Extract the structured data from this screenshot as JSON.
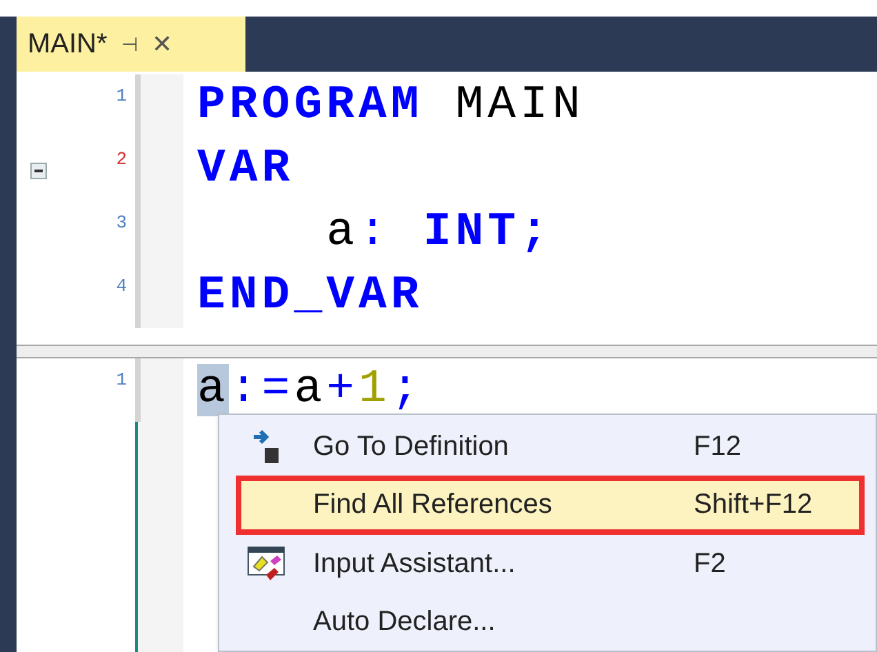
{
  "tab": {
    "title": "MAIN*",
    "pin": "⊣",
    "close": "✕",
    "selected": true
  },
  "top_pane": {
    "lines": [
      {
        "number": "1",
        "changed": false,
        "foldable": false,
        "tokens": [
          {
            "text": "PROGRAM",
            "kind": "keyword"
          },
          {
            "text": " MAIN",
            "kind": "ident"
          }
        ]
      },
      {
        "number": "2",
        "changed": true,
        "foldable": true,
        "tokens": [
          {
            "text": "VAR",
            "kind": "keyword"
          }
        ]
      },
      {
        "number": "3",
        "changed": false,
        "foldable": false,
        "tokens": [
          {
            "text": "    a",
            "kind": "ident"
          },
          {
            "text": ":",
            "kind": "punct"
          },
          {
            "text": " INT;",
            "kind": "keyword"
          }
        ]
      },
      {
        "number": "4",
        "changed": false,
        "foldable": false,
        "tokens": [
          {
            "text": "END_VAR",
            "kind": "keyword"
          }
        ]
      }
    ]
  },
  "bottom_pane": {
    "lines": [
      {
        "number": "1",
        "changed": false,
        "foldable": false,
        "tokens": [
          {
            "text": "a",
            "kind": "selected"
          },
          {
            "text": ":=",
            "kind": "punct"
          },
          {
            "text": "a",
            "kind": "ident"
          },
          {
            "text": "+",
            "kind": "punct"
          },
          {
            "text": "1",
            "kind": "number"
          },
          {
            "text": ";",
            "kind": "punct"
          }
        ]
      }
    ]
  },
  "context_menu": {
    "items": [
      {
        "label": "Go To Definition",
        "shortcut": "F12",
        "kind": "goto",
        "selected": false,
        "boxed": false
      },
      {
        "label": "Find All References",
        "shortcut": "Shift+F12",
        "kind": "plain",
        "selected": true,
        "boxed": true
      },
      {
        "label": "Input Assistant...",
        "shortcut": "F2",
        "kind": "assistant",
        "selected": false,
        "boxed": false
      },
      {
        "label": "Auto Declare...",
        "kind": "plain",
        "selected": false,
        "boxed": false
      }
    ]
  }
}
